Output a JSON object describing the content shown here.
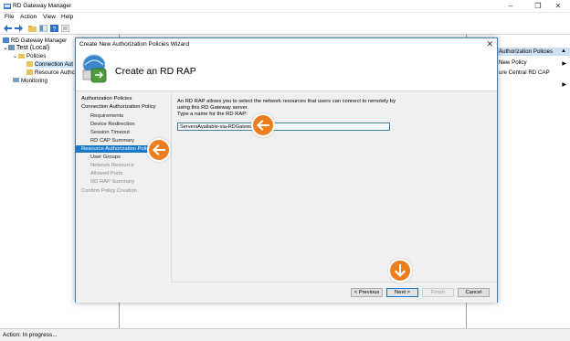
{
  "window": {
    "title": "RD Gateway Manager"
  },
  "menu": [
    "File",
    "Action",
    "View",
    "Help"
  ],
  "tree": {
    "root": "RD Gateway Manager",
    "server": "Test (Local)",
    "policies": "Policies",
    "connection": "Connection Aut",
    "resource": "Resource Authc",
    "monitoring": "Monitoring"
  },
  "actions": {
    "header": "Authorization Policies",
    "items": [
      "New Policy",
      "ure Central RD CAP"
    ]
  },
  "status": "Action:  In progress...",
  "wizard": {
    "title": "Create New Authorization Policies Wizard",
    "heading": "Create an RD RAP",
    "steps": [
      "Authorization Policies",
      "Connection Authorization Policy",
      "Requirements",
      "Device Redirection",
      "Session Timeout",
      "RD CAP Summary",
      "Resource Authorization Policy",
      "User Groups",
      "Network Resource",
      "Allowed Ports",
      "RD RAP Summary",
      "Confirm Policy Creation"
    ],
    "description_line1": "An RD RAP allows you to select the network resources that users can connect to remotely by",
    "description_line2": "using this RD Gateway server.",
    "description_line3": "Type a name for the RD RAP:",
    "name_value": "ServersAvailable-via-RDGateway",
    "buttons": {
      "previous": "< Previous",
      "next": "Next >",
      "finish": "Finish",
      "cancel": "Cancel"
    }
  },
  "colors": {
    "accent": "#1979ca",
    "callout": "#ee7d1d"
  }
}
